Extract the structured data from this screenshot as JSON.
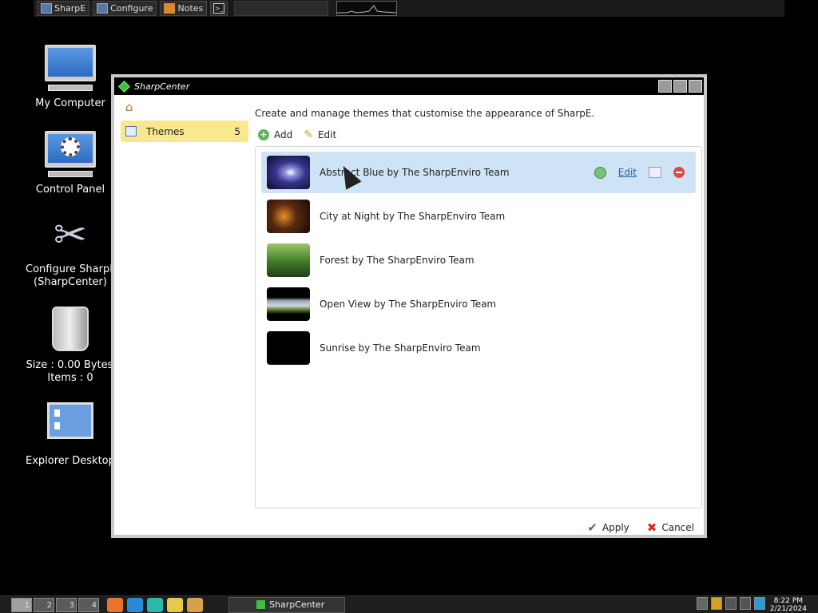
{
  "topbar": {
    "items": [
      {
        "label": "SharpE",
        "icon": "computer-icon"
      },
      {
        "label": "Configure",
        "icon": "computer-icon"
      },
      {
        "label": "Notes",
        "icon": "notes-icon"
      }
    ],
    "terminal_glyph": ">_"
  },
  "desktop": {
    "my_computer": "My Computer",
    "control_panel": "Control Panel",
    "configure_line1": "Configure SharpE",
    "configure_line2": "(SharpCenter)",
    "recycle_size": "Size : 0.00 Bytes",
    "recycle_items": "Items : 0",
    "explorer_desktop": "Explorer Desktop"
  },
  "window": {
    "title": "SharpCenter",
    "sidebar": {
      "item_label": "Themes",
      "item_count": "5"
    },
    "description": "Create and manage themes that customise the appearance of SharpE.",
    "actions": {
      "add": "Add",
      "edit": "Edit"
    },
    "themes": [
      {
        "label": "Abstract Blue by The SharpEnviro Team",
        "selected": true
      },
      {
        "label": "City at Night by The SharpEnviro Team",
        "selected": false
      },
      {
        "label": "Forest by The SharpEnviro Team",
        "selected": false
      },
      {
        "label": "Open View by The SharpEnviro Team",
        "selected": false
      },
      {
        "label": "Sunrise by The SharpEnviro Team",
        "selected": false
      }
    ],
    "row_tools": {
      "edit": "Edit"
    },
    "footer": {
      "apply": "Apply",
      "cancel": "Cancel"
    }
  },
  "taskbar": {
    "workspaces": [
      "1",
      "2",
      "3",
      "4"
    ],
    "task_label": "SharpCenter",
    "clock_time": "8:22 PM",
    "clock_date": "2/21/2024"
  },
  "colors": {
    "selected_row": "#cfe3f7",
    "sidebar_active": "#f8e88e",
    "link": "#1a5fb4"
  }
}
